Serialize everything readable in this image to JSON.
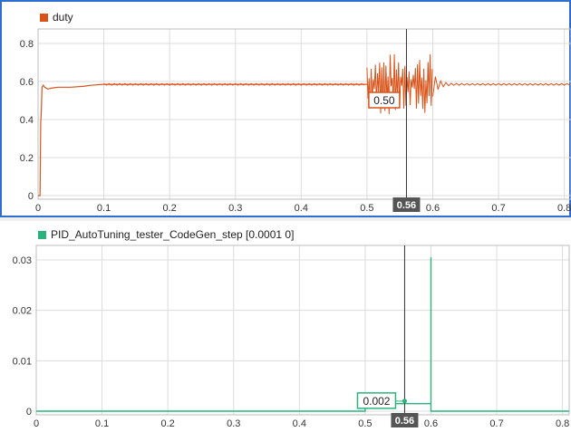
{
  "charts": {
    "top": {
      "legend_label": "duty",
      "color": "#d95319",
      "cursor_label": "0.56",
      "marker_label": "0.50"
    },
    "bottom": {
      "legend_label": "PID_AutoTuning_tester_CodeGen_step [0.0001 0]",
      "color": "#2cb37d",
      "cursor_label": "0.56",
      "marker_label": "0.002"
    }
  },
  "chart_data": [
    {
      "type": "line",
      "title": "",
      "xlabel": "",
      "ylabel": "",
      "xlim": [
        0,
        0.8
      ],
      "ylim": [
        0,
        0.8
      ],
      "x_ticks": [
        "0",
        "0.1",
        "0.2",
        "0.3",
        "0.4",
        "0.5",
        "0.6",
        "0.7",
        "0.8"
      ],
      "y_ticks": [
        "0",
        "0.2",
        "0.4",
        "0.6",
        "0.8"
      ],
      "grid": true,
      "legend": "top-left",
      "cursor_x": 0.56,
      "marker": {
        "x": 0.5,
        "y": 0.5,
        "label": "0.50"
      },
      "series": [
        {
          "name": "duty",
          "color": "#d95319",
          "x": [
            0,
            0.003,
            0.004,
            0.005,
            0.006,
            0.008,
            0.01,
            0.015,
            0.02,
            0.03,
            0.05,
            0.07,
            0.08,
            0.1,
            0.2,
            0.3,
            0.4,
            0.5
          ],
          "y": [
            0,
            0,
            0.38,
            0.45,
            0.57,
            0.58,
            0.57,
            0.56,
            0.565,
            0.57,
            0.57,
            0.575,
            0.58,
            0.585,
            0.585,
            0.585,
            0.585,
            0.585
          ],
          "oscillation": {
            "x_range": [
              0.5,
              0.6
            ],
            "y_range": [
              0.42,
              0.75
            ]
          },
          "after": {
            "x": [
              0.6,
              0.81
            ],
            "y": 0.585
          }
        }
      ]
    },
    {
      "type": "line",
      "title": "",
      "xlabel": "",
      "ylabel": "",
      "xlim": [
        0,
        0.8
      ],
      "ylim": [
        0,
        0.03
      ],
      "x_ticks": [
        "0",
        "0.1",
        "0.2",
        "0.3",
        "0.4",
        "0.5",
        "0.6",
        "0.7",
        "0.8"
      ],
      "y_ticks": [
        "0",
        "0.01",
        "0.02",
        "0.03"
      ],
      "grid": true,
      "legend": "top-left",
      "cursor_x": 0.56,
      "marker": {
        "x": 0.56,
        "y": 0.002,
        "label": "0.002"
      },
      "series": [
        {
          "name": "PID_AutoTuning_tester_CodeGen_step [0.0001 0]",
          "color": "#2cb37d",
          "x": [
            0,
            0.5,
            0.5,
            0.6,
            0.6,
            0.6,
            0.601,
            0.81
          ],
          "y": [
            0,
            0,
            0.0015,
            0.0015,
            0.0305,
            0,
            0,
            0
          ]
        }
      ]
    }
  ]
}
